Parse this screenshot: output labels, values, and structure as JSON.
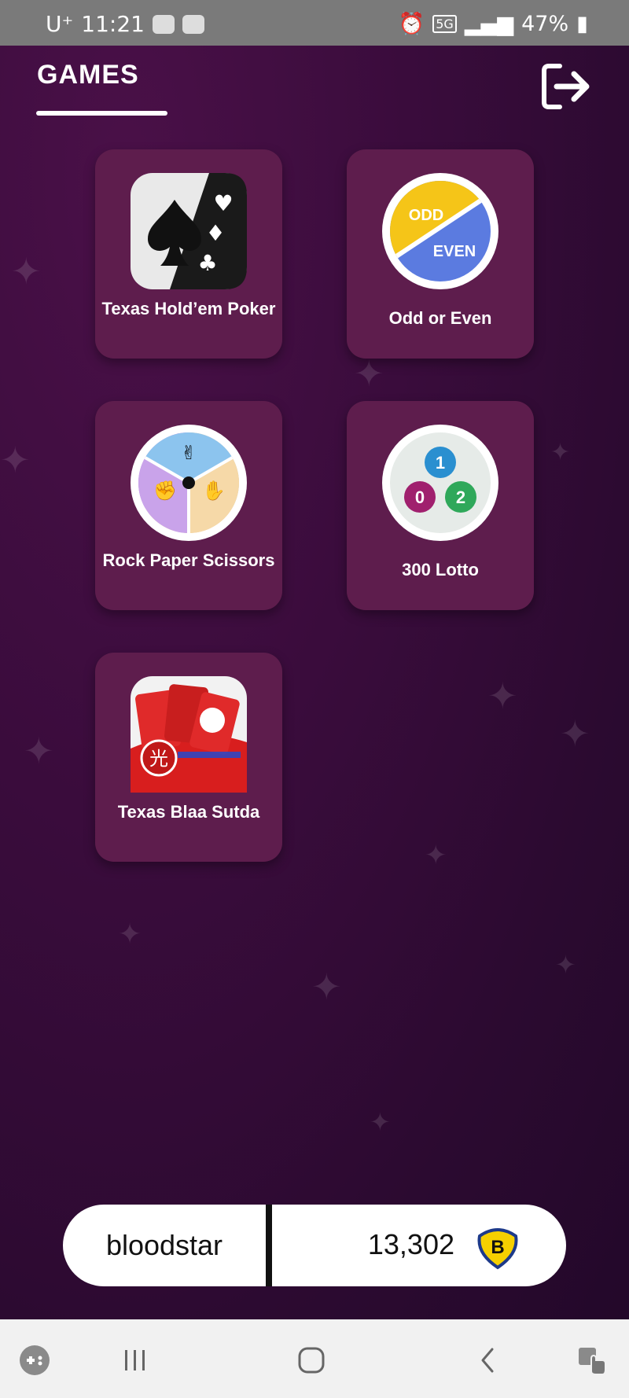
{
  "status_bar": {
    "carrier": "U⁺",
    "time": "11:21",
    "network": "5G",
    "battery": "47%"
  },
  "header": {
    "title": "GAMES"
  },
  "games": [
    {
      "label": "Texas Hold’em Poker"
    },
    {
      "label": "Odd or Even",
      "icon_text_top": "ODD",
      "icon_text_bottom": "EVEN"
    },
    {
      "label": "Rock Paper Scissors"
    },
    {
      "label": "300 Lotto",
      "balls": [
        "1",
        "0",
        "2"
      ]
    },
    {
      "label": "Texas Blaa Sutda",
      "icon_glyph": "光"
    }
  ],
  "footer": {
    "username": "bloodstar",
    "balance": "13,302",
    "coin_symbol": "B"
  },
  "colors": {
    "card": "#5e1d4d",
    "background": "#2b0a30",
    "odd": "#f5c518",
    "even": "#5b7be0"
  }
}
